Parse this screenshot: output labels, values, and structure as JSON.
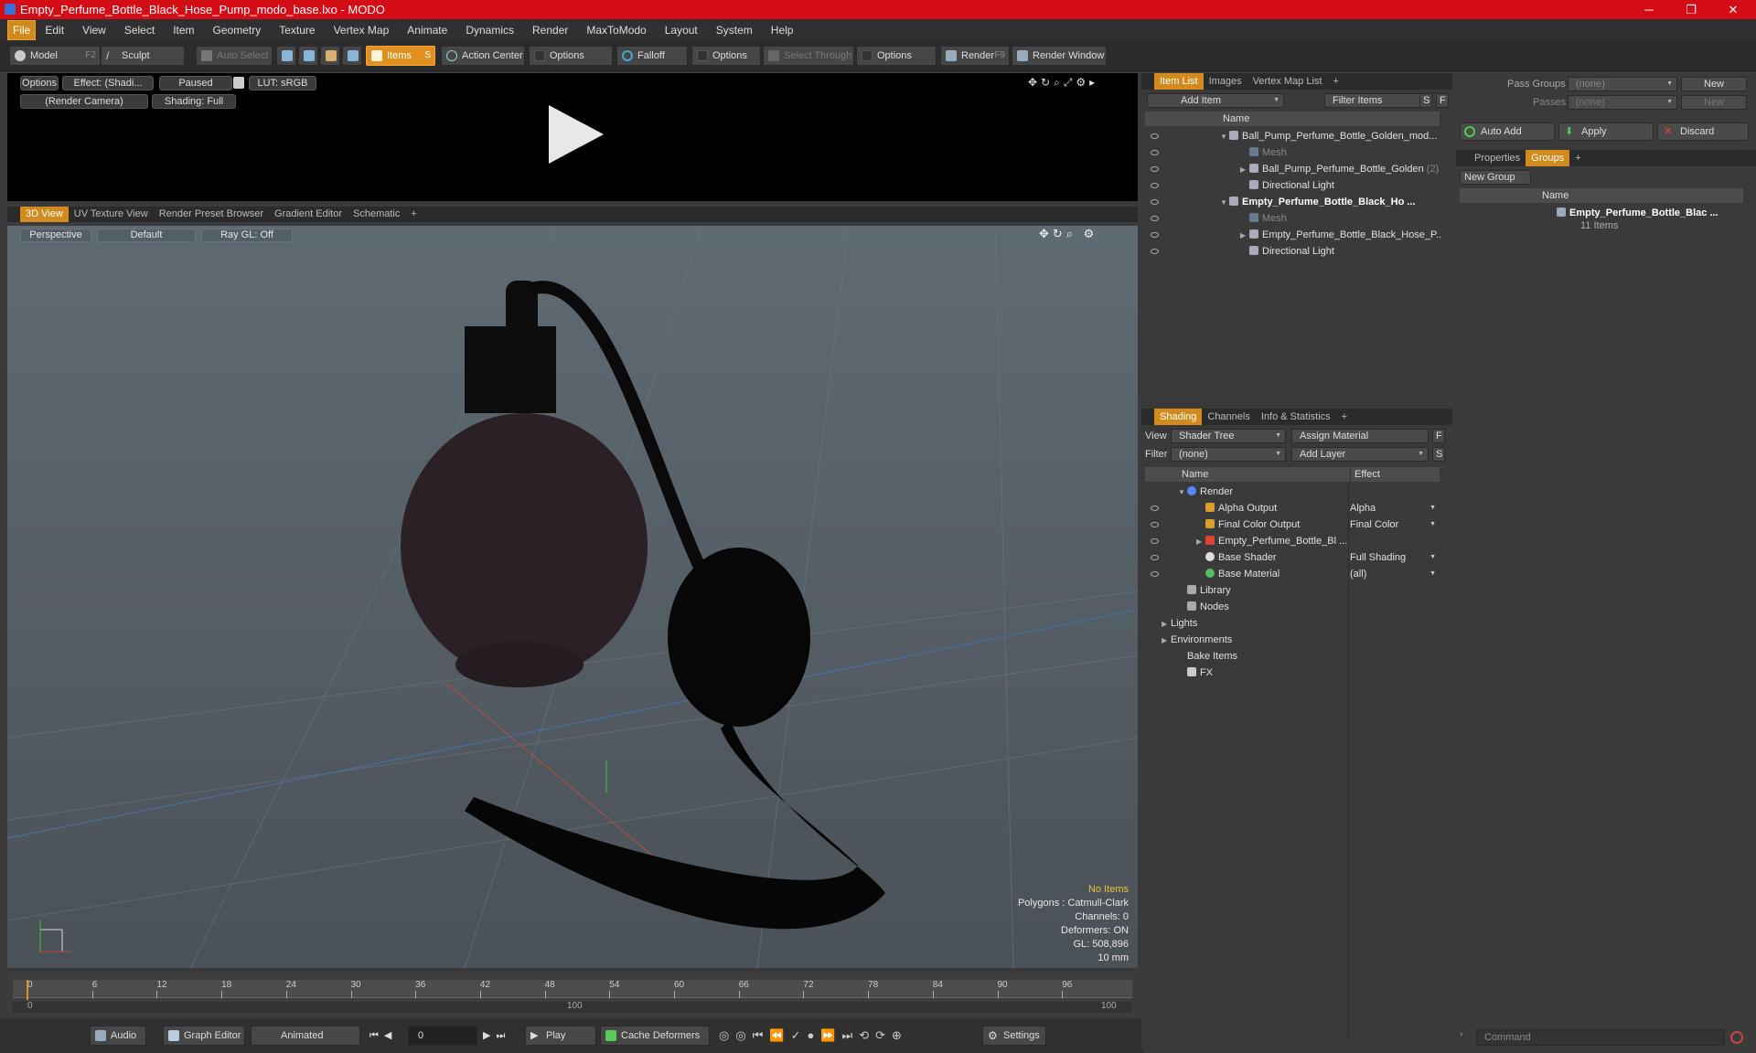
{
  "window": {
    "title": "Empty_Perfume_Bottle_Black_Hose_Pump_modo_base.lxo - MODO",
    "minimize": "─",
    "maximize": "❐",
    "close": "✕"
  },
  "menu": [
    "File",
    "Edit",
    "View",
    "Select",
    "Item",
    "Geometry",
    "Texture",
    "Vertex Map",
    "Animate",
    "Dynamics",
    "Render",
    "MaxToModo",
    "Layout",
    "System",
    "Help"
  ],
  "toolbar": {
    "model": "Model",
    "model_key": "F2",
    "sculpt": "Sculpt",
    "auto_select": "Auto Select",
    "items": "Items",
    "items_key": "S",
    "action_center": "Action Center",
    "options1": "Options",
    "falloff": "Falloff",
    "options2": "Options",
    "select_through": "Select Through",
    "options3": "Options",
    "render": "Render",
    "render_key": "F9",
    "render_window": "Render Window"
  },
  "preview": {
    "options": "Options",
    "effect": "Effect: (Shadi...",
    "paused": "Paused",
    "lut": "LUT: sRGB",
    "camera": "(Render Camera)",
    "shading": "Shading: Full"
  },
  "viewport_tabs": [
    "3D View",
    "UV Texture View",
    "Render Preset Browser",
    "Gradient Editor",
    "Schematic",
    "+"
  ],
  "viewport": {
    "perspective": "Perspective",
    "default": "Default",
    "raygl": "Ray GL: Off",
    "info": {
      "no_items": "No Items",
      "polygons": "Polygons : Catmull-Clark",
      "channels": "Channels: 0",
      "deformers": "Deformers: ON",
      "gl": "GL: 508,896",
      "scale": "10 mm"
    }
  },
  "timeline": {
    "ticks": [
      "0",
      "6",
      "12",
      "18",
      "24",
      "30",
      "36",
      "42",
      "48",
      "54",
      "60",
      "66",
      "72",
      "78",
      "84",
      "90",
      "96"
    ],
    "sub_start": "0",
    "sub_mid": "100",
    "sub_end": "100"
  },
  "bottombar": {
    "audio": "Audio",
    "graph_editor": "Graph Editor",
    "animated": "Animated",
    "frame": "0",
    "play": "Play",
    "cache_deformers": "Cache Deformers",
    "settings": "Settings"
  },
  "item_list": {
    "tabs": [
      "Item List",
      "Images",
      "Vertex Map List",
      "+"
    ],
    "add_item": "Add Item",
    "filter_items": "Filter Items",
    "s": "S",
    "f": "F",
    "col_name": "Name",
    "rows": [
      {
        "label": "Ball_Pump_Perfume_Bottle_Golden_mod...",
        "note": ""
      },
      {
        "label": "Mesh",
        "note": ""
      },
      {
        "label": "Ball_Pump_Perfume_Bottle_Golden",
        "note": "(2)"
      },
      {
        "label": "Directional Light",
        "note": ""
      },
      {
        "label": "Empty_Perfume_Bottle_Black_Ho ...",
        "note": ""
      },
      {
        "label": "Mesh",
        "note": ""
      },
      {
        "label": "Empty_Perfume_Bottle_Black_Hose_P...",
        "note": ""
      },
      {
        "label": "Directional Light",
        "note": ""
      }
    ]
  },
  "shading": {
    "tabs": [
      "Shading",
      "Channels",
      "Info & Statistics",
      "+"
    ],
    "view_label": "View",
    "view_value": "Shader Tree",
    "assign_material": "Assign Material",
    "f": "F",
    "filter_label": "Filter",
    "filter_value": "(none)",
    "add_layer": "Add Layer",
    "s": "S",
    "col_name": "Name",
    "col_effect": "Effect",
    "rows": [
      {
        "label": "Render",
        "effect": ""
      },
      {
        "label": "Alpha Output",
        "effect": "Alpha"
      },
      {
        "label": "Final Color Output",
        "effect": "Final Color"
      },
      {
        "label": "Empty_Perfume_Bottle_Bl ...",
        "effect": ""
      },
      {
        "label": "Base Shader",
        "effect": "Full Shading"
      },
      {
        "label": "Base Material",
        "effect": "(all)"
      },
      {
        "label": "Library",
        "effect": ""
      },
      {
        "label": "Nodes",
        "effect": ""
      },
      {
        "label": "Lights",
        "effect": ""
      },
      {
        "label": "Environments",
        "effect": ""
      },
      {
        "label": "Bake Items",
        "effect": ""
      },
      {
        "label": "FX",
        "effect": ""
      }
    ]
  },
  "groups": {
    "pass_groups_label": "Pass Groups",
    "pass_groups_value": "(none)",
    "new": "New",
    "passes_label": "Passes",
    "passes_value": "(none)",
    "new2": "New",
    "auto_add": "Auto Add",
    "apply": "Apply",
    "discard": "Discard",
    "tabs": [
      "Properties",
      "Groups",
      "+"
    ],
    "new_group": "New Group",
    "col_name": "Name",
    "group_name": "Empty_Perfume_Bottle_Blac ...",
    "group_count": "11 Items"
  },
  "command": {
    "placeholder": "Command"
  },
  "colors": {
    "accent": "#d08a1e",
    "titlebar": "#d40c16"
  }
}
